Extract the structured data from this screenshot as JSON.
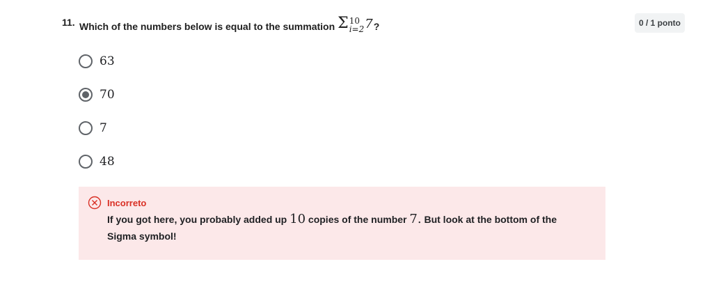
{
  "question": {
    "number": "11.",
    "text_before": "Which of the numbers below is equal to the summation",
    "sigma_symbol": "Σ",
    "upper_limit": "10",
    "lower_limit": "i=2",
    "term": "7",
    "text_after": "?"
  },
  "points_badge": "0 / 1 ponto",
  "options": [
    {
      "label": "63",
      "selected": false
    },
    {
      "label": "70",
      "selected": true
    },
    {
      "label": "7",
      "selected": false
    },
    {
      "label": "48",
      "selected": false
    }
  ],
  "feedback": {
    "status": "Incorreto",
    "text_part1": "If you got here, you probably added up",
    "math1": "10",
    "text_part2": "copies of the number",
    "math2": "7.",
    "text_part3": "But look at the bottom of the Sigma symbol!",
    "status_color": "#d93025",
    "background_color": "#fce8e9",
    "icon": "close-circle-icon"
  }
}
